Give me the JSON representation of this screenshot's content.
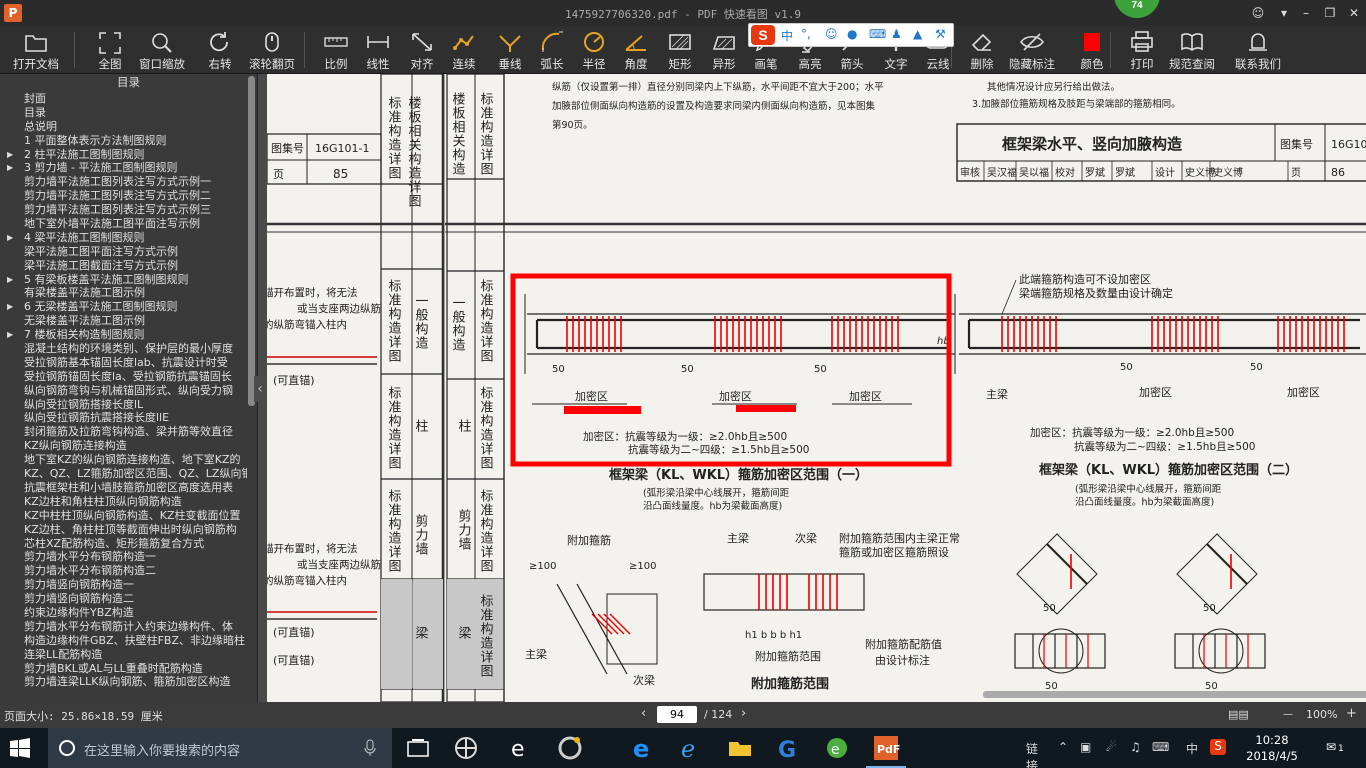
{
  "window": {
    "title": "1475927706320.pdf - PDF 快速看图 v1.9",
    "badge": "74",
    "app_icon": "P"
  },
  "toolbar": [
    {
      "id": "open",
      "label": "打开文档",
      "icon": "folder-icon"
    },
    {
      "id": "fit",
      "label": "全图",
      "icon": "fullscreen-icon"
    },
    {
      "id": "zoomwin",
      "label": "窗口缩放",
      "icon": "magnifier-icon"
    },
    {
      "id": "rotate",
      "label": "右转",
      "icon": "rotate-icon"
    },
    {
      "id": "wheel",
      "label": "滚轮翻页",
      "icon": "mouse-icon"
    },
    {
      "id": "scale",
      "label": "比例",
      "icon": "ruler-icon"
    },
    {
      "id": "linear",
      "label": "线性",
      "icon": "linear-measure-icon"
    },
    {
      "id": "align",
      "label": "对齐",
      "icon": "align-measure-icon"
    },
    {
      "id": "continuous",
      "label": "连续",
      "icon": "continuous-measure-icon"
    },
    {
      "id": "perp",
      "label": "垂线",
      "icon": "perpendicular-icon"
    },
    {
      "id": "arc",
      "label": "弧长",
      "icon": "arc-icon"
    },
    {
      "id": "radius",
      "label": "半径",
      "icon": "radius-icon"
    },
    {
      "id": "angle",
      "label": "角度",
      "icon": "angle-icon"
    },
    {
      "id": "rect",
      "label": "矩形",
      "icon": "rectangle-area-icon"
    },
    {
      "id": "irregular",
      "label": "异形",
      "icon": "irregular-area-icon"
    },
    {
      "id": "pen",
      "label": "画笔",
      "icon": "pen-icon"
    },
    {
      "id": "highlight",
      "label": "高亮",
      "icon": "highlight-icon"
    },
    {
      "id": "arrow",
      "label": "箭头",
      "icon": "arrow-icon"
    },
    {
      "id": "text",
      "label": "文字",
      "icon": "text-icon"
    },
    {
      "id": "cloud",
      "label": "云线",
      "icon": "cloud-line-icon"
    },
    {
      "id": "delete",
      "label": "删除",
      "icon": "eraser-icon"
    },
    {
      "id": "hide",
      "label": "隐藏标注",
      "icon": "eye-hidden-icon"
    },
    {
      "id": "color",
      "label": "颜色",
      "icon": "color-swatch-icon"
    },
    {
      "id": "print",
      "label": "打印",
      "icon": "printer-icon"
    },
    {
      "id": "norms",
      "label": "规范查阅",
      "icon": "book-icon"
    },
    {
      "id": "contact",
      "label": "联系我们",
      "icon": "contact-icon"
    }
  ],
  "ime": {
    "logo": "S",
    "mode": "中"
  },
  "sidebar": {
    "title": "目录",
    "items": [
      {
        "text": "封面",
        "lvl": 0,
        "arrow": false
      },
      {
        "text": "目录",
        "lvl": 0,
        "arrow": false
      },
      {
        "text": "总说明",
        "lvl": 0,
        "arrow": false
      },
      {
        "text": "1 平面整体表示方法制图规则",
        "lvl": 0,
        "arrow": false
      },
      {
        "text": "2 柱平法施工图制图规则",
        "lvl": 0,
        "arrow": true
      },
      {
        "text": "3 剪力墙 - 平法施工图制图规则",
        "lvl": 0,
        "arrow": true
      },
      {
        "text": "剪力墙平法施工图列表注写方式示例一",
        "lvl": 1,
        "arrow": false
      },
      {
        "text": "剪力墙平法施工图列表注写方式示例二",
        "lvl": 1,
        "arrow": false
      },
      {
        "text": "剪力墙平法施工图列表注写方式示例三",
        "lvl": 1,
        "arrow": false
      },
      {
        "text": "地下室外墙平法施工图平面注写示例",
        "lvl": 1,
        "arrow": false
      },
      {
        "text": "4 梁平法施工图制图规则",
        "lvl": 0,
        "arrow": true
      },
      {
        "text": "梁平法施工图平面注写方式示例",
        "lvl": 1,
        "arrow": false
      },
      {
        "text": "梁平法施工图截面注写方式示例",
        "lvl": 1,
        "arrow": false
      },
      {
        "text": "5 有梁板楼盖平法施工图制图规则",
        "lvl": 0,
        "arrow": true
      },
      {
        "text": "有梁楼盖平法施工图示例",
        "lvl": 1,
        "arrow": false
      },
      {
        "text": "6 无梁楼盖平法施工图制图规则",
        "lvl": 0,
        "arrow": true
      },
      {
        "text": "无梁楼盖平法施工图示例",
        "lvl": 1,
        "arrow": false
      },
      {
        "text": "7 楼板相关构造制图规则",
        "lvl": 0,
        "arrow": true
      },
      {
        "text": "混凝土结构的环境类别、保护层的最小厚度",
        "lvl": 1,
        "arrow": false
      },
      {
        "text": "受拉钢筋基本锚固长度lab、抗震设计时受",
        "lvl": 1,
        "arrow": false
      },
      {
        "text": "受拉钢筋锚固长度la、受拉钢筋抗震锚固长",
        "lvl": 1,
        "arrow": false
      },
      {
        "text": "纵向钢筋弯钩与机械锚固形式、纵向受力钢",
        "lvl": 1,
        "arrow": false
      },
      {
        "text": "纵向受拉钢筋搭接长度lL",
        "lvl": 1,
        "arrow": false
      },
      {
        "text": "纵向受拉钢筋抗震搭接长度llE",
        "lvl": 1,
        "arrow": false
      },
      {
        "text": "封闭箍筋及拉筋弯钩构造、梁并筋等效直径",
        "lvl": 1,
        "arrow": false
      },
      {
        "text": "KZ纵向钢筋连接构造",
        "lvl": 1,
        "arrow": false
      },
      {
        "text": "地下室KZ的纵向钢筋连接构造、地下室KZ的",
        "lvl": 1,
        "arrow": false
      },
      {
        "text": "KZ、QZ、LZ箍筋加密区范围、QZ、LZ纵向钢",
        "lvl": 1,
        "arrow": false
      },
      {
        "text": "抗震框架柱和小墙肢箍筋加密区高度选用表",
        "lvl": 1,
        "arrow": false
      },
      {
        "text": "KZ边柱和角柱柱顶纵向钢筋构造",
        "lvl": 1,
        "arrow": false
      },
      {
        "text": "KZ中柱柱顶纵向钢筋构造、KZ柱变截面位置",
        "lvl": 1,
        "arrow": false
      },
      {
        "text": "KZ边柱、角柱柱顶等截面伸出时纵向钢筋构",
        "lvl": 1,
        "arrow": false
      },
      {
        "text": "芯柱XZ配筋构造、矩形箍筋复合方式",
        "lvl": 1,
        "arrow": false
      },
      {
        "text": "剪力墙水平分布钢筋构造一",
        "lvl": 1,
        "arrow": false
      },
      {
        "text": "剪力墙水平分布钢筋构造二",
        "lvl": 1,
        "arrow": false
      },
      {
        "text": "剪力墙竖向钢筋构造一",
        "lvl": 1,
        "arrow": false
      },
      {
        "text": "剪力墙竖向钢筋构造二",
        "lvl": 1,
        "arrow": false
      },
      {
        "text": "约束边缘构件YBZ构造",
        "lvl": 1,
        "arrow": false
      },
      {
        "text": "剪力墙水平分布钢筋计入约束边缘构件、体",
        "lvl": 1,
        "arrow": false
      },
      {
        "text": "构造边缘构件GBZ、扶壁柱FBZ、非边缘暗柱",
        "lvl": 1,
        "arrow": false
      },
      {
        "text": "连梁LL配筋构造",
        "lvl": 1,
        "arrow": false
      },
      {
        "text": "剪力墙BKL或AL与LL重叠时配筋构造",
        "lvl": 1,
        "arrow": false
      },
      {
        "text": "剪力墙连梁LLK纵向钢筋、箍筋加密区构造",
        "lvl": 1,
        "arrow": false
      }
    ]
  },
  "document": {
    "left_page": {
      "side_cells": [
        "楼板相关构造详图",
        "标准构造详图",
        "一般构造",
        "标准构造详图",
        "柱",
        "标准构造详图",
        "剪力墙",
        "标准构造详图",
        "梁"
      ],
      "atlas_label": "图集号",
      "atlas_no": "16G101-1",
      "page_label": "页",
      "page_no": "85",
      "note1": "锚开布置时，将无法",
      "note2": "或当支座两边纵筋",
      "note3": "的纵筋弯锚入柱内",
      "tag1": "(可直锚)",
      "tag2": "(可直锚)",
      "tag3": "(可直锚)"
    },
    "right_page": {
      "top_text1": "纵筋（仅设置第一排）直径分别同梁内上下纵筋，水平间距不宜大于200；水平",
      "top_text2": "加腋部位侧面纵向构造筋的设置及构造要求同梁内侧面纵向构造筋，见本图集",
      "top_text3": "第90页。",
      "top_right1": "其他情况设计应另行给出做法。",
      "top_right2": "3.加腋部位箍筋规格及肢距与梁端部的箍筋相同。",
      "title_block": "框架梁水平、竖向加腋构造",
      "atlas_label": "图集号",
      "atlas_no": "16G101-1",
      "page_label": "页",
      "page_no": "86",
      "sign_row": [
        "审核",
        "吴汉福",
        "吴以福",
        "校对",
        "罗斌",
        "罗斌",
        "设计",
        "史义博",
        "史义博",
        "页"
      ],
      "side_cells": [
        "楼板相关构造",
        "标准构造详图",
        "一般构造",
        "标准构造详图",
        "柱",
        "标准构造详图",
        "剪力墙",
        "标准构造详图",
        "梁",
        "标准构造详图"
      ],
      "dense_zone": "加密区",
      "dim50": "50",
      "hb": "hb",
      "fig1_note1": "加密区：抗震等级为一级：≥2.0hb且≥500",
      "fig1_note2": "抗震等级为二~四级：≥1.5hb且≥500",
      "fig1_title": "框架梁（KL、WKL）箍筋加密区范围（一）",
      "fig1_sub1": "(弧形梁沿梁中心线展开，箍筋间距",
      "fig1_sub2": "沿凸面线量度。hb为梁截面高度)",
      "fig2_top1": "此端箍筋构造可不设加密区",
      "fig2_top2": "梁端箍筋规格及数量由设计确定",
      "fig2_main": "主梁",
      "fig2_note1": "加密区：抗震等级为一级：≥2.0hb且≥500",
      "fig2_note2": "抗震等级为二~四级：≥1.5hb且≥500",
      "fig2_title": "框架梁（KL、WKL）箍筋加密区范围（二）",
      "fig2_sub1": "(弧形梁沿梁中心线展开，箍筋间距",
      "fig2_sub2": "沿凸面线量度。hb为梁截面高度)",
      "fig3_label": "附加箍筋",
      "fig3_main": "主梁",
      "fig3_sec": "次梁",
      "fig3_100a": "≥100",
      "fig3_100b": "≥100",
      "fig4_main": "主梁",
      "fig4_sec": "次梁",
      "fig4_note1": "附加箍筋范围内主梁正常",
      "fig4_note2": "箍筋或加密区箍筋照设",
      "fig4_note3": "附加箍筋配筋值",
      "fig4_note4": "由设计标注",
      "fig4_range": "附加箍筋范围",
      "fig4_title": "附加箍筋范围",
      "fig4_dims": "h1  b  b  b  h1"
    }
  },
  "status": {
    "page_size": "页面大小: 25.86×18.59 厘米",
    "current_page": "94",
    "total_pages": "/ 124",
    "zoom": "100%",
    "prev": "‹",
    "next": "›",
    "minus": "—",
    "plus": "+"
  },
  "taskbar": {
    "search_placeholder": "在这里输入你要搜索的内容",
    "tray_link": "链接",
    "ime_lang": "中",
    "time": "10:28",
    "date": "2018/4/5",
    "notif": "1"
  },
  "colors": {
    "accent_red": "#ff0000",
    "toolbar_bg": "#2f2f2f",
    "taskbar_bg": "#101820"
  }
}
